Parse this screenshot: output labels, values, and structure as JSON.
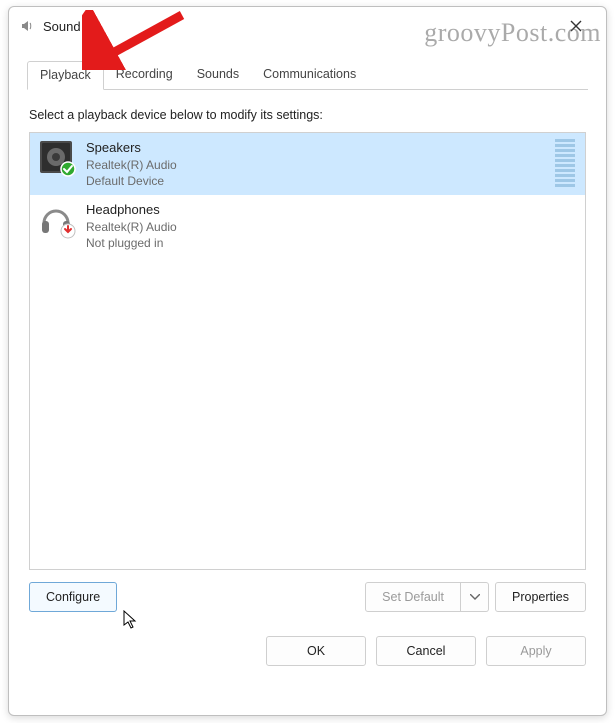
{
  "window": {
    "title": "Sound"
  },
  "tabs": [
    {
      "label": "Playback",
      "active": true
    },
    {
      "label": "Recording",
      "active": false
    },
    {
      "label": "Sounds",
      "active": false
    },
    {
      "label": "Communications",
      "active": false
    }
  ],
  "instruction": "Select a playback device below to modify its settings:",
  "devices": [
    {
      "name": "Speakers",
      "driver": "Realtek(R) Audio",
      "status": "Default Device",
      "selected": true,
      "badge": "check"
    },
    {
      "name": "Headphones",
      "driver": "Realtek(R) Audio",
      "status": "Not plugged in",
      "selected": false,
      "badge": "unplugged"
    }
  ],
  "buttons": {
    "configure": "Configure",
    "set_default": "Set Default",
    "properties": "Properties",
    "ok": "OK",
    "cancel": "Cancel",
    "apply": "Apply"
  },
  "watermark": "groovyPost.com"
}
